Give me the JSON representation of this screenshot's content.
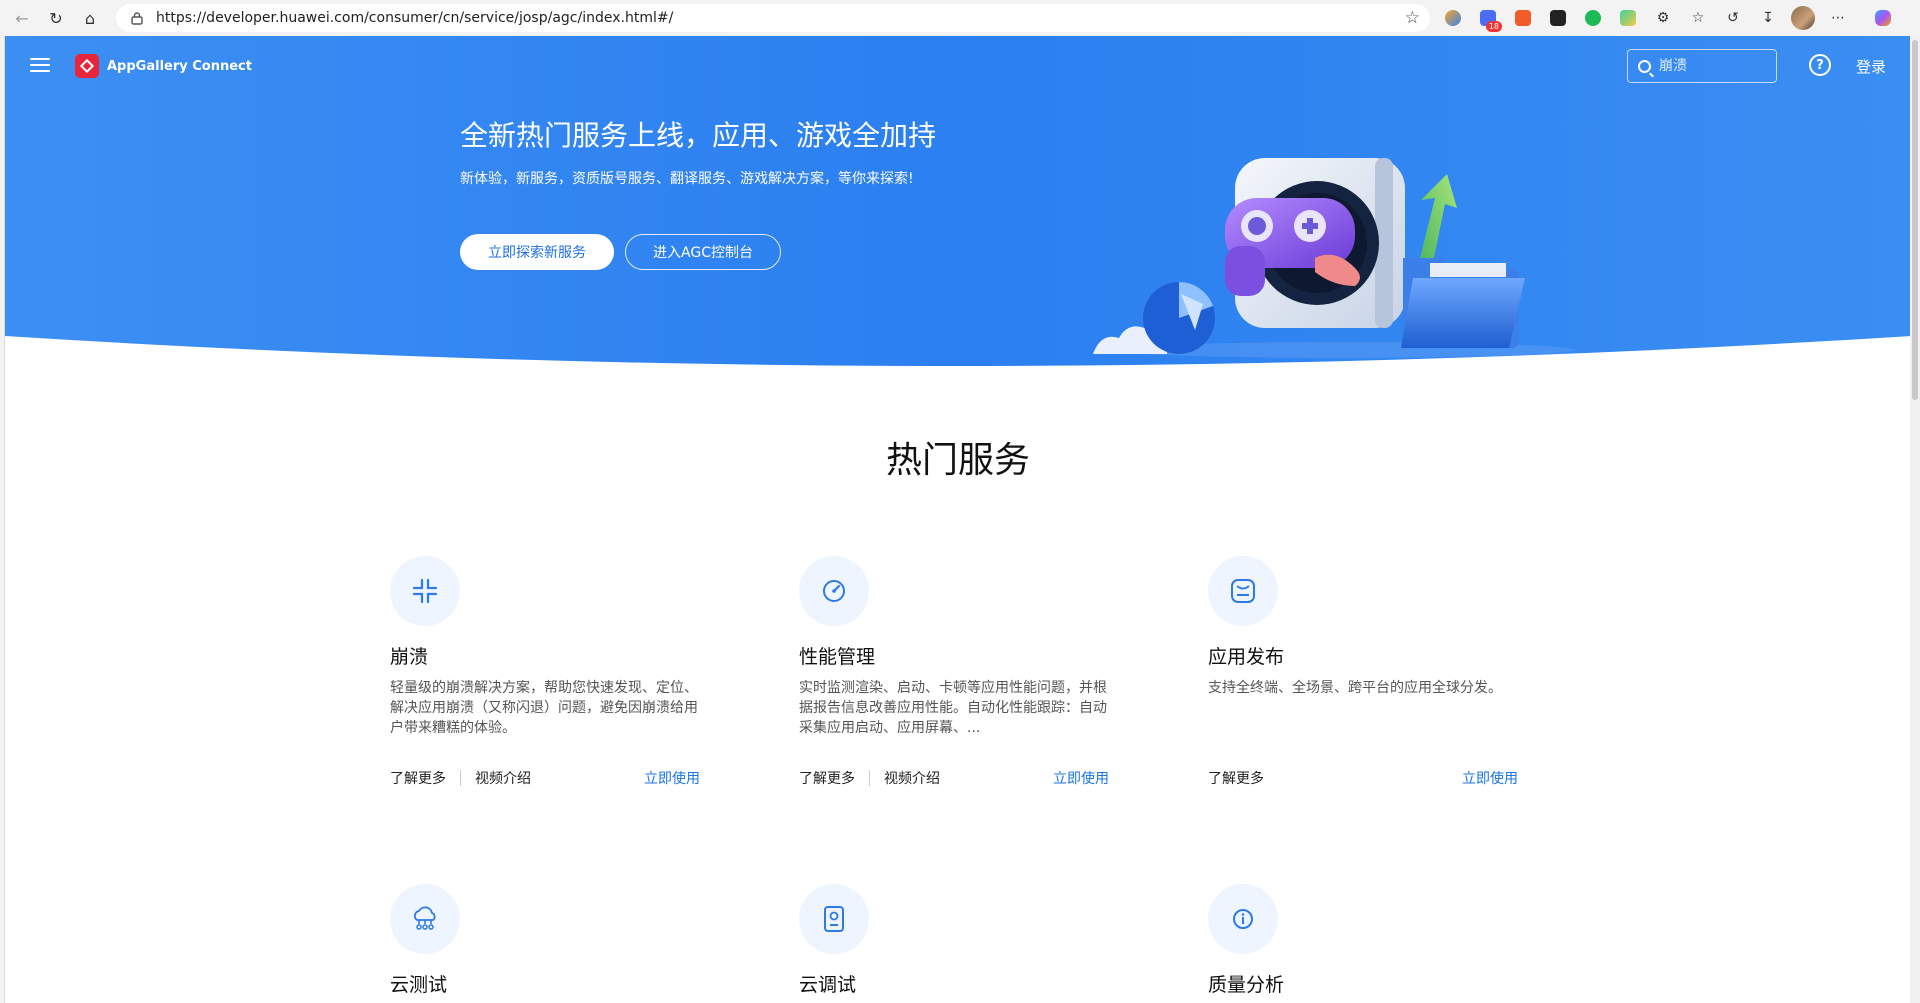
{
  "browser": {
    "url": "https://developer.huawei.com/consumer/cn/service/josp/agc/index.html#/",
    "badge_count": "18"
  },
  "header": {
    "brand": "AppGallery Connect",
    "search_placeholder": "崩溃",
    "login": "登录"
  },
  "hero": {
    "title": "全新热门服务上线，应用、游戏全加持",
    "subtitle": "新体验，新服务，资质版号服务、翻译服务、游戏解决方案，等你来探索!",
    "primary_button": "立即探索新服务",
    "secondary_button": "进入AGC控制台"
  },
  "section": {
    "title": "热门服务"
  },
  "cards": [
    {
      "title": "崩溃",
      "desc": "轻量级的崩溃解决方案，帮助您快速发现、定位、解决应用崩溃（又称闪退）问题，避免因崩溃给用户带来糟糕的体验。",
      "learn": "了解更多",
      "video": "视频介绍",
      "use": "立即使用",
      "icon": "crash-icon"
    },
    {
      "title": "性能管理",
      "desc": "实时监测渲染、启动、卡顿等应用性能问题，并根据报告信息改善应用性能。自动化性能跟踪：自动采集应用启动、应用屏幕、...",
      "learn": "了解更多",
      "video": "视频介绍",
      "use": "立即使用",
      "icon": "speedometer-icon"
    },
    {
      "title": "应用发布",
      "desc": "支持全终端、全场景、跨平台的应用全球分发。",
      "learn": "了解更多",
      "use": "立即使用",
      "icon": "app-publish-icon"
    },
    {
      "title": "云测试",
      "icon": "cloud-test-icon"
    },
    {
      "title": "云调试",
      "icon": "cloud-debug-icon"
    },
    {
      "title": "质量分析",
      "icon": "quality-icon"
    }
  ],
  "colors": {
    "hero_blue": "#2b7ff0",
    "link_blue": "#1a73e8",
    "icon_bg": "#eef5ff",
    "brand_red": "#e8253a"
  }
}
